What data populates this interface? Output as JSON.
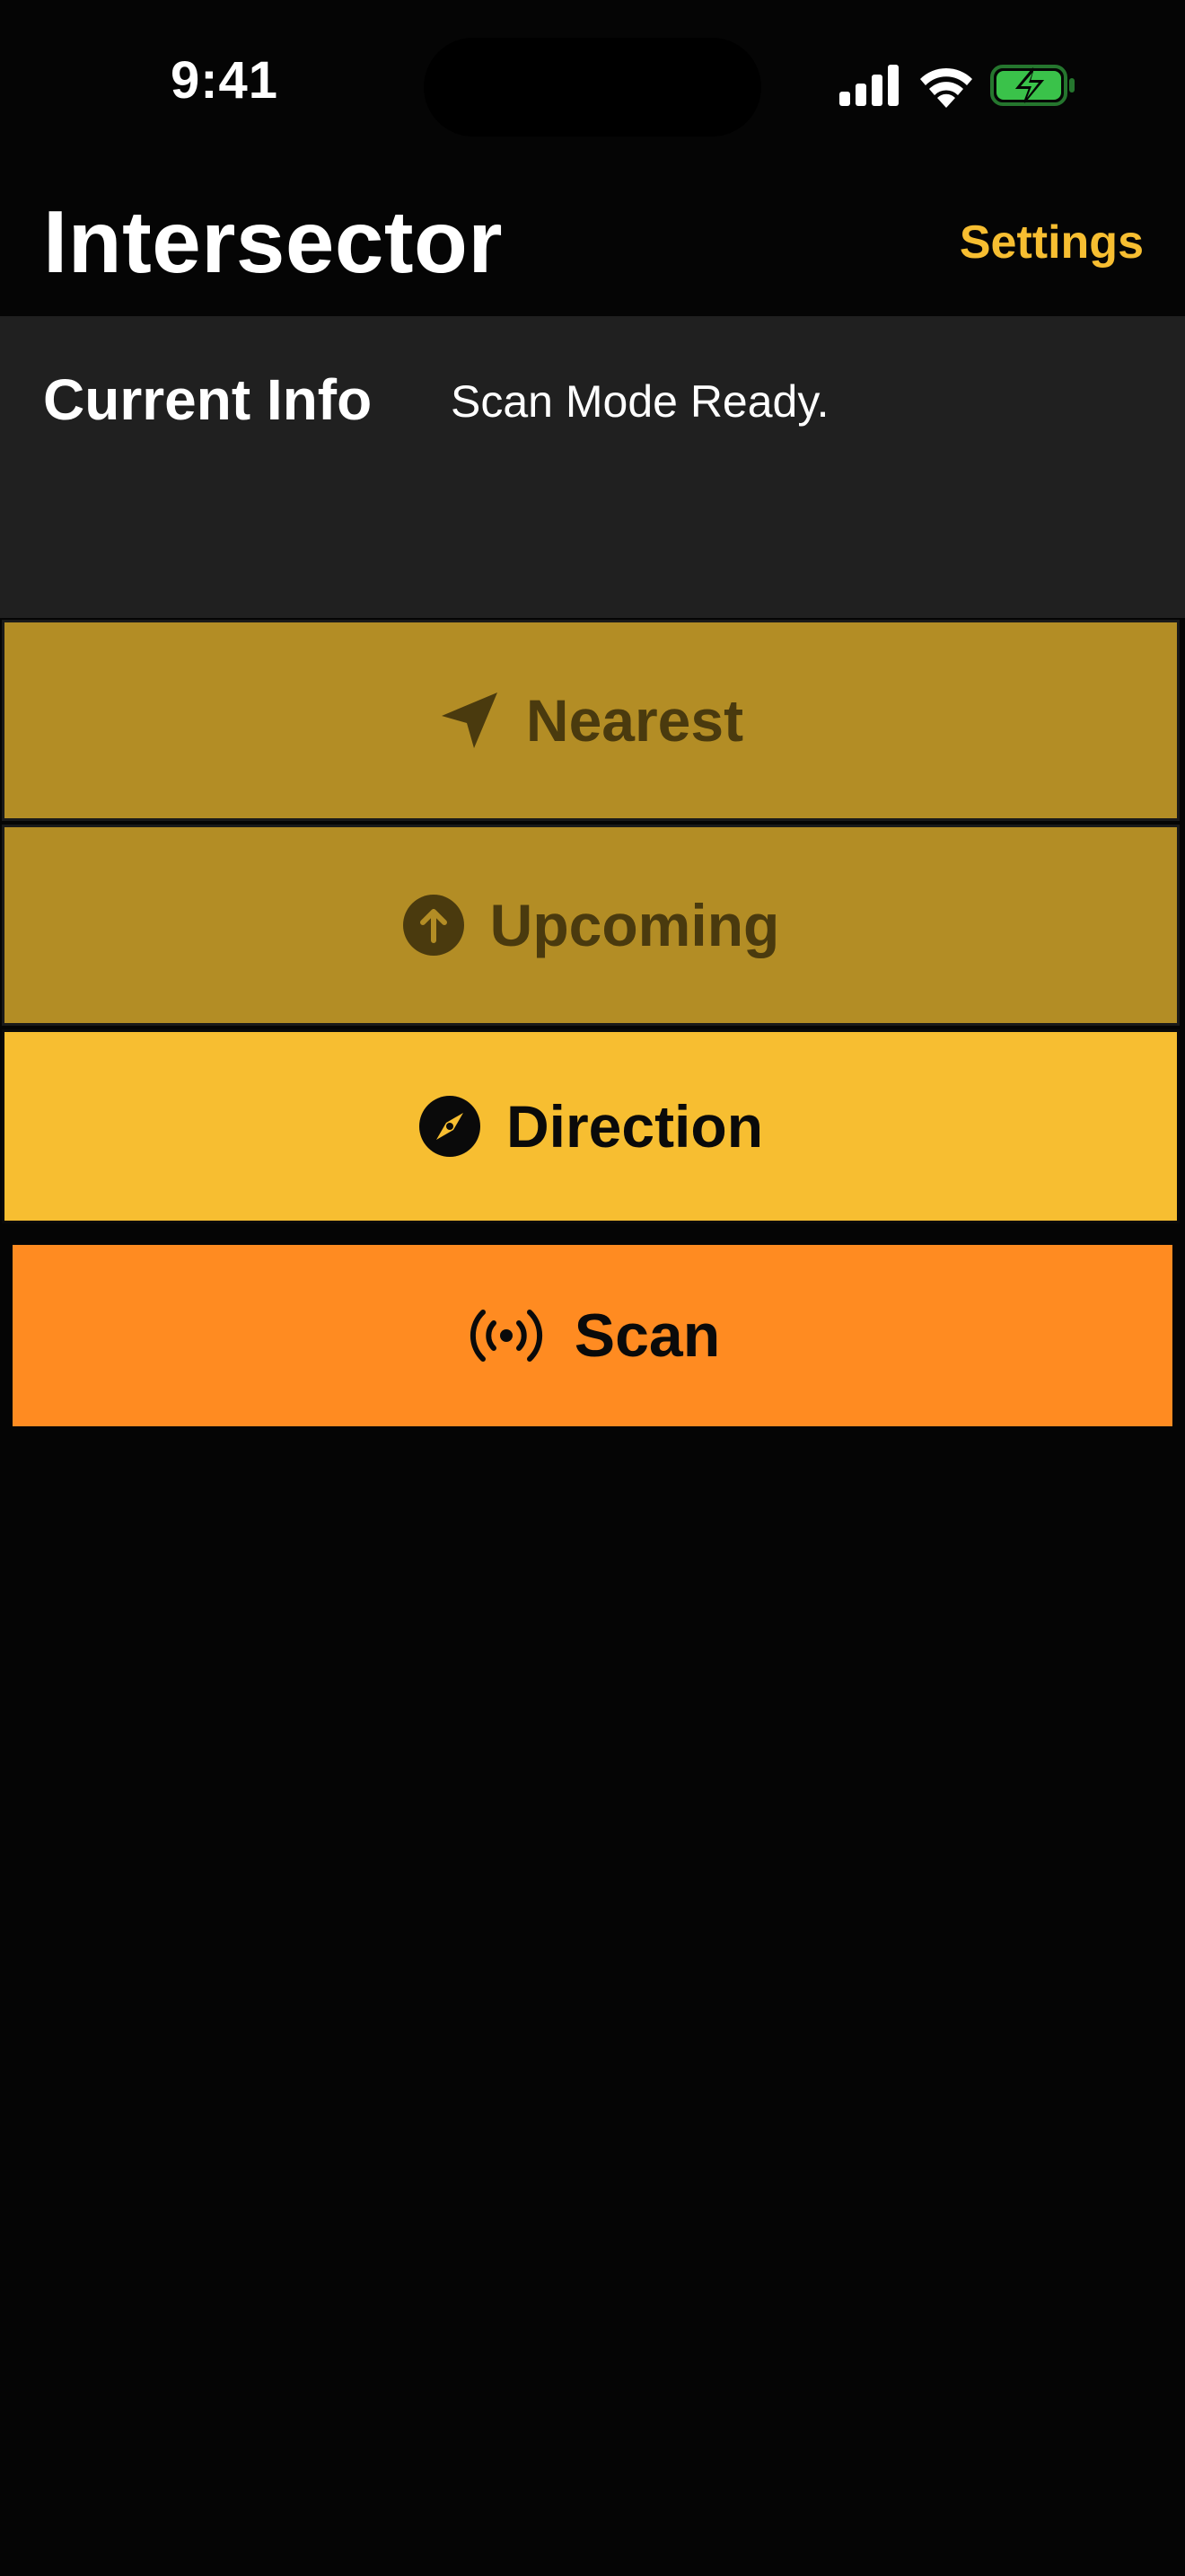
{
  "status_bar": {
    "time": "9:41",
    "icons": [
      "cellular-signal-icon",
      "wifi-icon",
      "battery-charging-icon"
    ],
    "battery_color": "#3ac24a"
  },
  "header": {
    "title": "Intersector",
    "settings_label": "Settings",
    "accent_color": "#f7be31"
  },
  "info": {
    "label": "Current Info",
    "status": "Scan Mode Ready."
  },
  "modes": {
    "nearest": {
      "label": "Nearest",
      "icon": "location-arrow-icon",
      "state": "disabled"
    },
    "upcoming": {
      "label": "Upcoming",
      "icon": "arrow-up-circle-icon",
      "state": "disabled"
    },
    "direction": {
      "label": "Direction",
      "icon": "compass-icon",
      "state": "active"
    }
  },
  "scan": {
    "label": "Scan",
    "icon": "broadcast-waves-icon",
    "color": "#ff8b21"
  }
}
